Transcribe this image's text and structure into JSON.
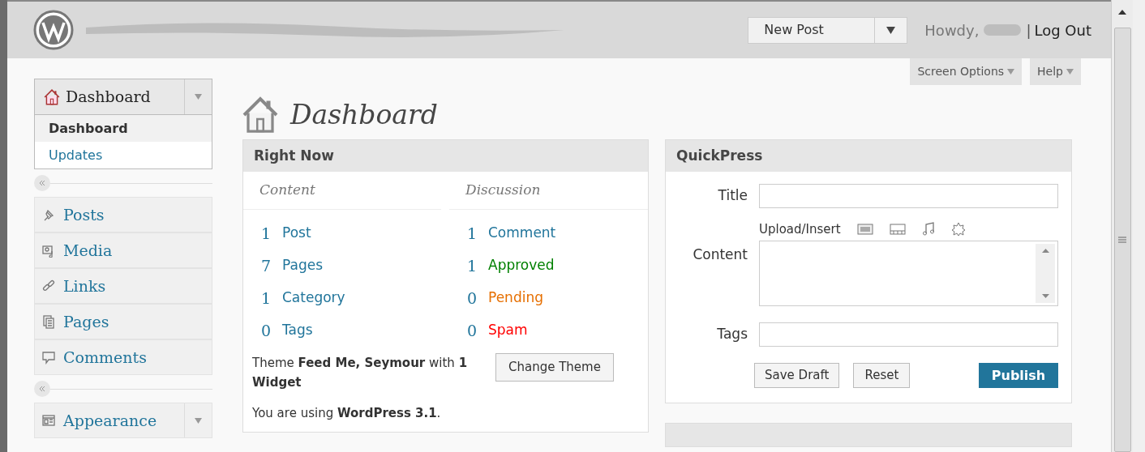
{
  "header": {
    "new_post": "New Post",
    "greeting": "Howdy,",
    "separator": "|",
    "logout": "Log Out"
  },
  "screen_options": [
    {
      "label": "Screen Options"
    },
    {
      "label": "Help"
    }
  ],
  "sidebar": {
    "top": {
      "label": "Dashboard",
      "expanded": true,
      "children": [
        {
          "label": "Dashboard",
          "selected": true
        },
        {
          "label": "Updates",
          "selected": false
        }
      ]
    },
    "groups": [
      [
        {
          "label": "Posts"
        },
        {
          "label": "Media"
        },
        {
          "label": "Links"
        },
        {
          "label": "Pages"
        },
        {
          "label": "Comments"
        }
      ],
      [
        {
          "label": "Appearance",
          "expanded": false
        }
      ]
    ]
  },
  "page_title": "Dashboard",
  "right_now": {
    "title": "Right Now",
    "content_heading": "Content",
    "discussion_heading": "Discussion",
    "content": [
      {
        "count": "1",
        "label": "Post"
      },
      {
        "count": "7",
        "label": "Pages"
      },
      {
        "count": "1",
        "label": "Category"
      },
      {
        "count": "0",
        "label": "Tags"
      }
    ],
    "discussion": [
      {
        "count": "1",
        "label": "Comment",
        "color": "#21759b"
      },
      {
        "count": "1",
        "label": "Approved",
        "color": "#008000"
      },
      {
        "count": "0",
        "label": "Pending",
        "color": "#e66f00"
      },
      {
        "count": "0",
        "label": "Spam",
        "color": "#ff0000"
      }
    ],
    "theme_text": "Theme **Feed Me, Seymour** with **1 Widget**",
    "change_theme": "Change Theme",
    "version_text": "You are using **WordPress 3.1**."
  },
  "quickpress": {
    "title": "QuickPress",
    "title_label": "Title",
    "upload_label": "Upload/Insert",
    "content_label": "Content",
    "tags_label": "Tags",
    "save_draft": "Save Draft",
    "reset": "Reset",
    "publish": "Publish"
  }
}
